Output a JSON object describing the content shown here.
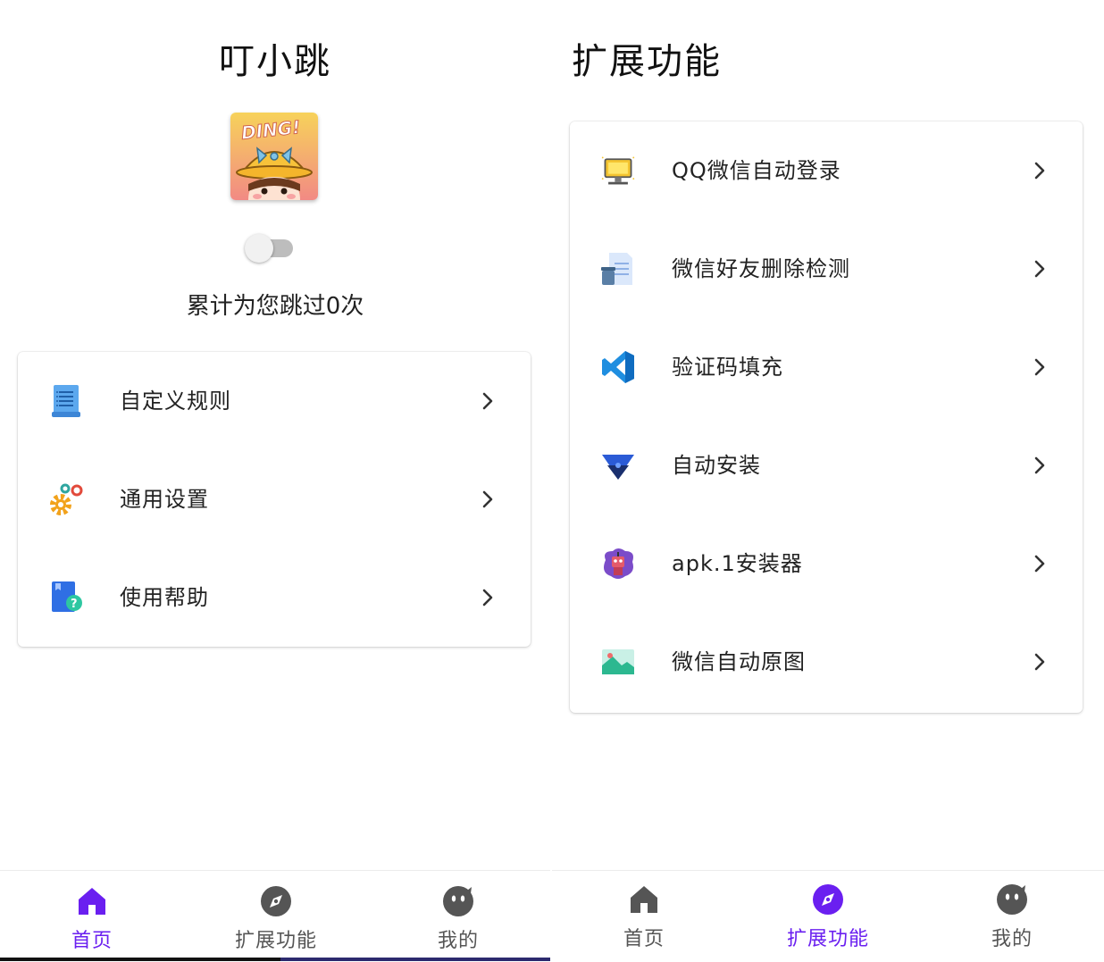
{
  "left": {
    "app_title": "叮小跳",
    "avatar_text": "DING!",
    "switch_on": false,
    "count_text": "累计为您跳过0次",
    "menu": [
      {
        "label": "自定义规则",
        "icon": "document-list-icon"
      },
      {
        "label": "通用设置",
        "icon": "gears-icon"
      },
      {
        "label": "使用帮助",
        "icon": "help-book-icon"
      }
    ],
    "nav": [
      {
        "label": "首页",
        "icon": "home-icon",
        "active": true
      },
      {
        "label": "扩展功能",
        "icon": "compass-icon",
        "active": false
      },
      {
        "label": "我的",
        "icon": "face-icon",
        "active": false
      }
    ]
  },
  "right": {
    "title": "扩展功能",
    "items": [
      {
        "label": "QQ微信自动登录",
        "icon": "monitor-icon"
      },
      {
        "label": "微信好友删除检测",
        "icon": "trash-document-icon"
      },
      {
        "label": "验证码填充",
        "icon": "vscode-icon"
      },
      {
        "label": "自动安装",
        "icon": "triangle-install-icon"
      },
      {
        "label": "apk.1安装器",
        "icon": "robot-icon"
      },
      {
        "label": "微信自动原图",
        "icon": "image-icon"
      }
    ],
    "nav": [
      {
        "label": "首页",
        "icon": "home-icon",
        "active": false
      },
      {
        "label": "扩展功能",
        "icon": "compass-icon",
        "active": true
      },
      {
        "label": "我的",
        "icon": "face-icon",
        "active": false
      }
    ]
  },
  "colors": {
    "accent": "#6a1ff0",
    "nav_inactive": "#555555",
    "chevron": "#333333"
  }
}
